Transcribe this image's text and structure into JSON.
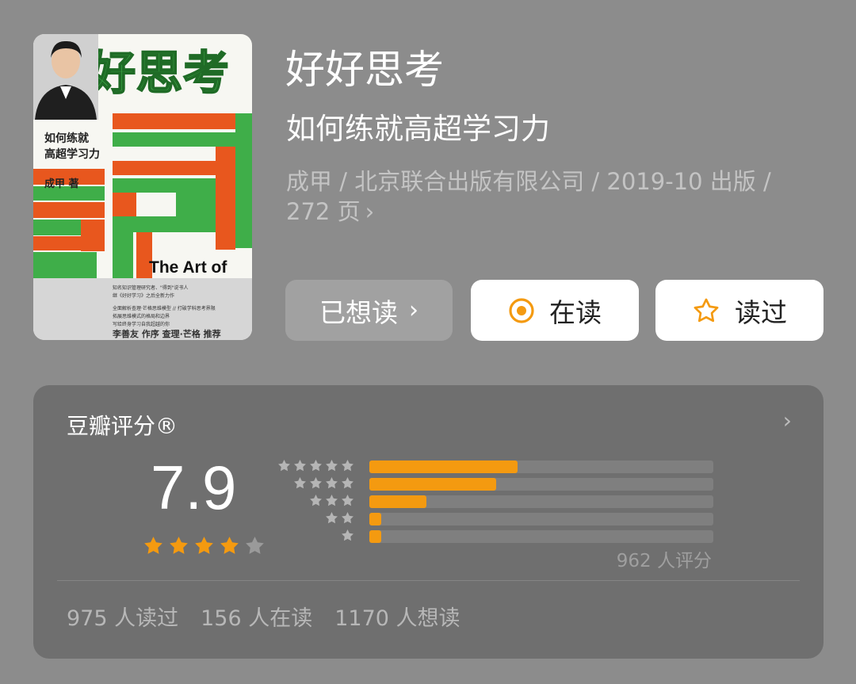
{
  "cover": {
    "title": "好好思考",
    "subtitle_line1": "如何练就",
    "subtitle_line2": "高超学习力",
    "author": "成甲  著",
    "english": "The  Art of",
    "blurb_1": "知名知识管理研究者、\"得到\"说书人",
    "blurb_2": "继《好好学习》之后全新力作",
    "blurb_3": "全面解析查理·芒格思维模型 // 打破学科思考界限",
    "blurb_4": "拓展思维模式的格局和边界",
    "blurb_5": "写给终身学习自我超越的你",
    "blurb_6": "李善友 作序  查理·芒格 推荐",
    "side_tag": "成甲"
  },
  "book": {
    "title": "好好思考",
    "subtitle": "如何练就高超学习力",
    "meta": "成甲 / 北京联合出版有限公司 / 2019-10 出版 / 272 页",
    "meta_chevron": "›"
  },
  "actions": {
    "want": "已想读",
    "want_chevron": "›",
    "reading": "在读",
    "read": "读过"
  },
  "rating": {
    "label": "豆瓣评分®",
    "chevron": "›",
    "score": "7.9",
    "star_fill": 4,
    "count_label": "962 人评分",
    "distribution": [
      {
        "stars": 5,
        "fraction": 0.43
      },
      {
        "stars": 4,
        "fraction": 0.368
      },
      {
        "stars": 3,
        "fraction": 0.165
      },
      {
        "stars": 2,
        "fraction": 0.035
      },
      {
        "stars": 1,
        "fraction": 0.035
      }
    ]
  },
  "stats": {
    "read": "975 人读过",
    "reading": "156 人在读",
    "want": "1170 人想读"
  },
  "colors": {
    "background": "#8c8c8c",
    "panel": "#6f6f6f",
    "accent_orange": "#f49a10",
    "cover_green": "#3fae49",
    "cover_orange": "#e8571e"
  },
  "icons": {
    "reading": "target-circle-icon",
    "read": "star-outline-icon",
    "want": "chevron-right-icon"
  }
}
